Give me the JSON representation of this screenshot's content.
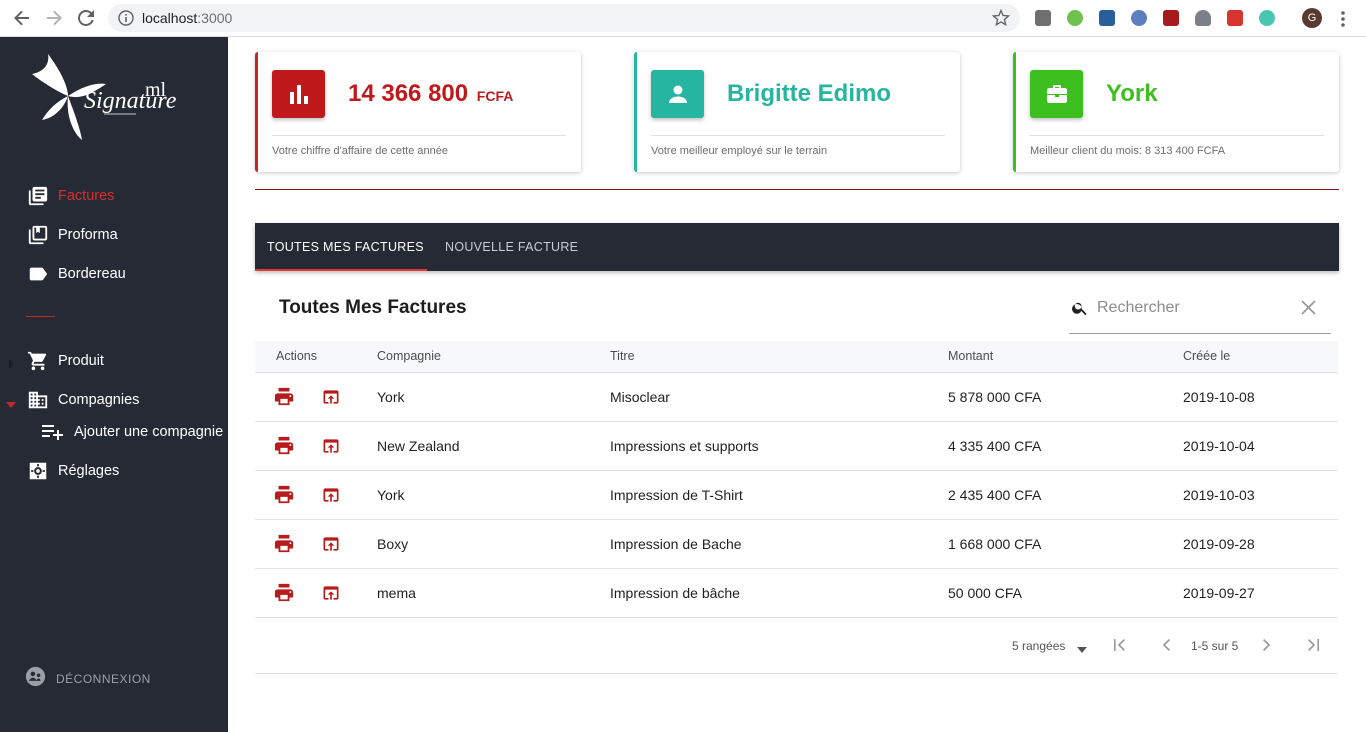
{
  "browser": {
    "url_host": "localhost",
    "url_port": ":3000",
    "profile_initial": "G"
  },
  "sidebar": {
    "logo_text": "Signature ml",
    "items": [
      {
        "label": "Factures",
        "icon": "receipt-list-icon",
        "active": true
      },
      {
        "label": "Proforma",
        "icon": "library-books-icon",
        "active": false
      },
      {
        "label": "Bordereau",
        "icon": "label-icon",
        "active": false
      },
      {
        "label": "Produit",
        "icon": "cart-icon",
        "active": false
      },
      {
        "label": "Compagnies",
        "icon": "business-icon",
        "active": false
      },
      {
        "label": "Réglages",
        "icon": "settings-icon",
        "active": false
      }
    ],
    "sub_item": {
      "label": "Ajouter une compagnie",
      "icon": "playlist-add-icon"
    },
    "logout_label": "DÉCONNEXION"
  },
  "cards": [
    {
      "value": "14 366 800",
      "unit": "FCFA",
      "caption": "Votre chiffre d'affaire de cette année",
      "color": "#c62828",
      "icon": "bar-chart-icon"
    },
    {
      "value": "Brigitte Edimo",
      "unit": "",
      "caption": "Votre meilleur employé sur le terrain",
      "color": "#26b5a0",
      "icon": "person-icon"
    },
    {
      "value": "York",
      "unit": "",
      "caption": "Meilleur client du mois: 8 313 400 FCFA",
      "color": "#3cbf1f",
      "icon": "briefcase-icon"
    }
  ],
  "tabs": [
    {
      "label": "TOUTES MES FACTURES",
      "active": true
    },
    {
      "label": "NOUVELLE FACTURE",
      "active": false
    }
  ],
  "table": {
    "title": "Toutes Mes Factures",
    "search_placeholder": "Rechercher",
    "headers": {
      "actions": "Actions",
      "company": "Compagnie",
      "title": "Titre",
      "amount": "Montant",
      "created": "Créée le"
    },
    "rows": [
      {
        "company": "York",
        "title": "Misoclear",
        "amount": "5 878 000 CFA",
        "created": "2019-10-08"
      },
      {
        "company": "New Zealand",
        "title": "Impressions et supports",
        "amount": "4 335 400 CFA",
        "created": "2019-10-04"
      },
      {
        "company": "York",
        "title": "Impression de T-Shirt",
        "amount": "2 435 400 CFA",
        "created": "2019-10-03"
      },
      {
        "company": "Boxy",
        "title": "Impression de Bache",
        "amount": "1 668 000 CFA",
        "created": "2019-09-28"
      },
      {
        "company": "mema",
        "title": "Impression de bâche",
        "amount": "50 000 CFA",
        "created": "2019-09-27"
      }
    ],
    "pagination": {
      "rows_label": "5 rangées",
      "range": "1-5 sur 5"
    }
  },
  "colors": {
    "sidebar_bg": "#252a35",
    "accent_red": "#c62828",
    "icon_red": "#b71c1c"
  }
}
